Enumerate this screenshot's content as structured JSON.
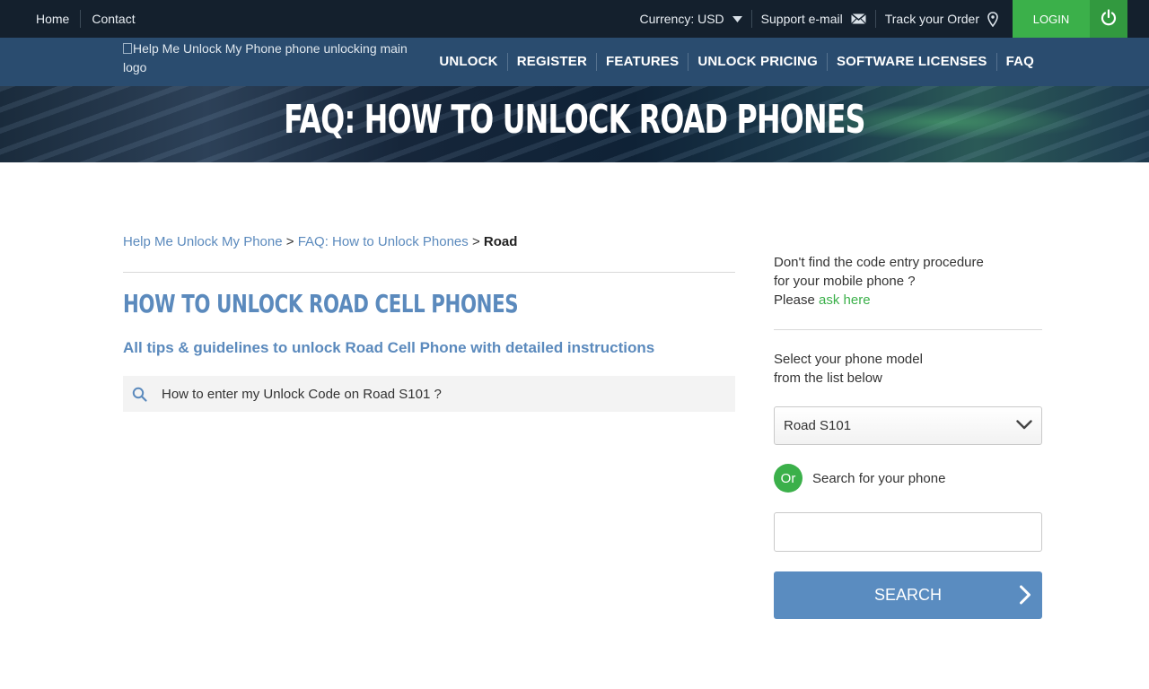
{
  "topbar": {
    "links": [
      "Home",
      "Contact"
    ],
    "currency_label": "Currency: USD",
    "support_label": "Support e-mail",
    "track_label": "Track your Order",
    "login_label": "LOGIN"
  },
  "navbar": {
    "logo_alt": "Help Me Unlock My Phone phone unlocking main logo",
    "items": [
      "UNLOCK",
      "REGISTER",
      "FEATURES",
      "UNLOCK PRICING",
      "SOFTWARE LICENSES",
      "FAQ"
    ]
  },
  "hero": {
    "title": "FAQ: HOW TO UNLOCK ROAD PHONES"
  },
  "breadcrumb": {
    "home": "Help Me Unlock My Phone",
    "sep": ">",
    "faq": "FAQ: How to Unlock Phones",
    "current": "Road"
  },
  "main": {
    "title": "HOW TO UNLOCK ROAD CELL PHONES",
    "subtitle": "All tips & guidelines to unlock Road Cell Phone with detailed instructions",
    "faq_items": [
      "How to enter my Unlock Code on Road S101 ?"
    ]
  },
  "sidebar": {
    "question_line1": "Don't find the code entry procedure",
    "question_line2": "for your mobile phone ?",
    "please": "Please",
    "ask_link": "ask here",
    "select_line1": "Select your phone model",
    "select_line2": "from the list below",
    "selected_model": "Road S101",
    "or_label": "Or",
    "search_label": "Search for your phone",
    "search_value": "",
    "search_button": "SEARCH"
  },
  "colors": {
    "topbar_bg": "#14202d",
    "nav_bg": "#2a4c6f",
    "accent_blue": "#5b8abd",
    "accent_green": "#3bb04a"
  }
}
